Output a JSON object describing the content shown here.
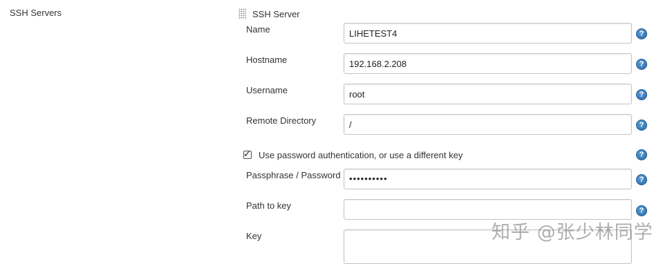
{
  "section": {
    "label": "SSH Servers"
  },
  "server_block": {
    "title": "SSH Server"
  },
  "fields": {
    "name": {
      "label": "Name",
      "value": "LIHETEST4"
    },
    "hostname": {
      "label": "Hostname",
      "value": "192.168.2.208"
    },
    "username": {
      "label": "Username",
      "value": "root"
    },
    "remote_directory": {
      "label": "Remote Directory",
      "value": "/"
    },
    "use_password": {
      "label": "Use password authentication, or use a different key",
      "checked": true
    },
    "passphrase": {
      "label": "Passphrase / Password",
      "value": "••••••••••"
    },
    "path_to_key": {
      "label": "Path to key",
      "value": ""
    },
    "key": {
      "label": "Key",
      "value": ""
    }
  },
  "help_icon": {
    "glyph": "?",
    "color": "#2a6aa8"
  },
  "watermark": {
    "text": "知乎 @张少林同学"
  }
}
